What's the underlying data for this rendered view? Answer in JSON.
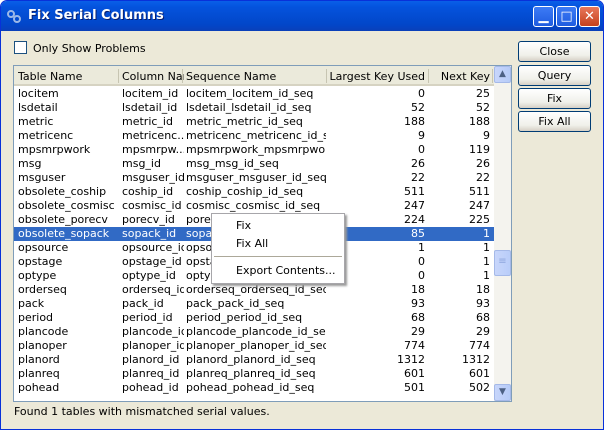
{
  "window": {
    "title": "Fix Serial Columns",
    "icon": "gears-icon"
  },
  "filter": {
    "only_show_problems_label": "Only Show Problems",
    "only_show_problems_checked": false
  },
  "table": {
    "columns": [
      "Table Name",
      "Column Nam",
      "Sequence Name",
      "Largest Key Used",
      "Next Key"
    ],
    "selected_index": 10,
    "rows": [
      [
        "locitem",
        "locitem_id",
        "locitem_locitem_id_seq",
        "0",
        "25"
      ],
      [
        "lsdetail",
        "lsdetail_id",
        "lsdetail_lsdetail_id_seq",
        "52",
        "52"
      ],
      [
        "metric",
        "metric_id",
        "metric_metric_id_seq",
        "188",
        "188"
      ],
      [
        "metricenc",
        "metricenc...",
        "metricenc_metricenc_id_seq",
        "9",
        "9"
      ],
      [
        "mpsmrpwork",
        "mpsmrpw...",
        "mpsmrpwork_mpsmrpwork...",
        "0",
        "119"
      ],
      [
        "msg",
        "msg_id",
        "msg_msg_id_seq",
        "26",
        "26"
      ],
      [
        "msguser",
        "msguser_id",
        "msguser_msguser_id_seq",
        "22",
        "22"
      ],
      [
        "obsolete_coship",
        "coship_id",
        "coship_coship_id_seq",
        "511",
        "511"
      ],
      [
        "obsolete_cosmisc",
        "cosmisc_id",
        "cosmisc_cosmisc_id_seq",
        "247",
        "247"
      ],
      [
        "obsolete_porecv",
        "porecv_id",
        "porecv_porecv_id_seq",
        "224",
        "225"
      ],
      [
        "obsolete_sopack",
        "sopack_id",
        "sopack_sopack_id_seq",
        "85",
        "1"
      ],
      [
        "opsource",
        "opsource_id",
        "opsource_opsource_id_seq",
        "1",
        "1"
      ],
      [
        "opstage",
        "opstage_id",
        "opstage_opstage_id_seq",
        "0",
        "1"
      ],
      [
        "optype",
        "optype_id",
        "optype_optype_id_seq",
        "0",
        "1"
      ],
      [
        "orderseq",
        "orderseq_id",
        "orderseq_orderseq_id_seq",
        "18",
        "18"
      ],
      [
        "pack",
        "pack_id",
        "pack_pack_id_seq",
        "93",
        "93"
      ],
      [
        "period",
        "period_id",
        "period_period_id_seq",
        "68",
        "68"
      ],
      [
        "plancode",
        "plancode_id",
        "plancode_plancode_id_seq",
        "29",
        "29"
      ],
      [
        "planoper",
        "planoper_id",
        "planoper_planoper_id_seq",
        "774",
        "774"
      ],
      [
        "planord",
        "planord_id",
        "planord_planord_id_seq",
        "1312",
        "1312"
      ],
      [
        "planreq",
        "planreq_id",
        "planreq_planreq_id_seq",
        "601",
        "601"
      ],
      [
        "pohead",
        "pohead_id",
        "pohead_pohead_id_seq",
        "501",
        "502"
      ]
    ]
  },
  "buttons": {
    "close": "Close",
    "query": "Query",
    "fix": "Fix",
    "fix_all": "Fix All"
  },
  "context_menu": {
    "fix": "Fix",
    "fix_all": "Fix All",
    "export": "Export Contents..."
  },
  "status": "Found 1 tables with mismatched serial values.",
  "colors": {
    "selection": "#316ac5",
    "titlebar": "#0453dd"
  }
}
